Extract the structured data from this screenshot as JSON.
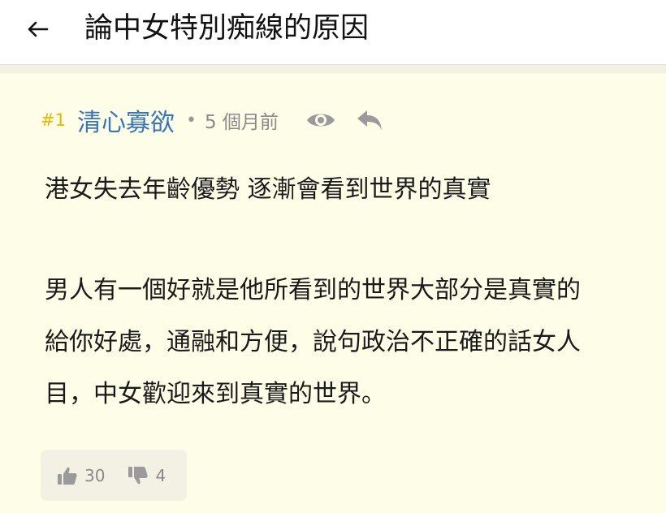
{
  "header": {
    "title": "論中女特別痴線的原因",
    "back_icon": "arrow-left-icon"
  },
  "post": {
    "floor": "#1",
    "author": "清心寡欲",
    "separator": "•",
    "time": "5 個月前",
    "icons": {
      "view": "eye-icon",
      "reply": "reply-icon"
    },
    "colors": {
      "floor": "#e6b800",
      "author": "#3775b8",
      "background": "#fefde8"
    },
    "content": {
      "line1": "港女失去年齡優勢 逐漸會看到世界的真實",
      "line2": "男人有一個好就是他所看到的世界大部分是真實的",
      "line3": "給你好處，通融和方便，說句政治不正確的話女人",
      "line4": "目，中女歡迎來到真實的世界。"
    },
    "votes": {
      "up_icon": "thumbs-up-icon",
      "up": "30",
      "down_icon": "thumbs-down-icon",
      "down": "4"
    }
  }
}
